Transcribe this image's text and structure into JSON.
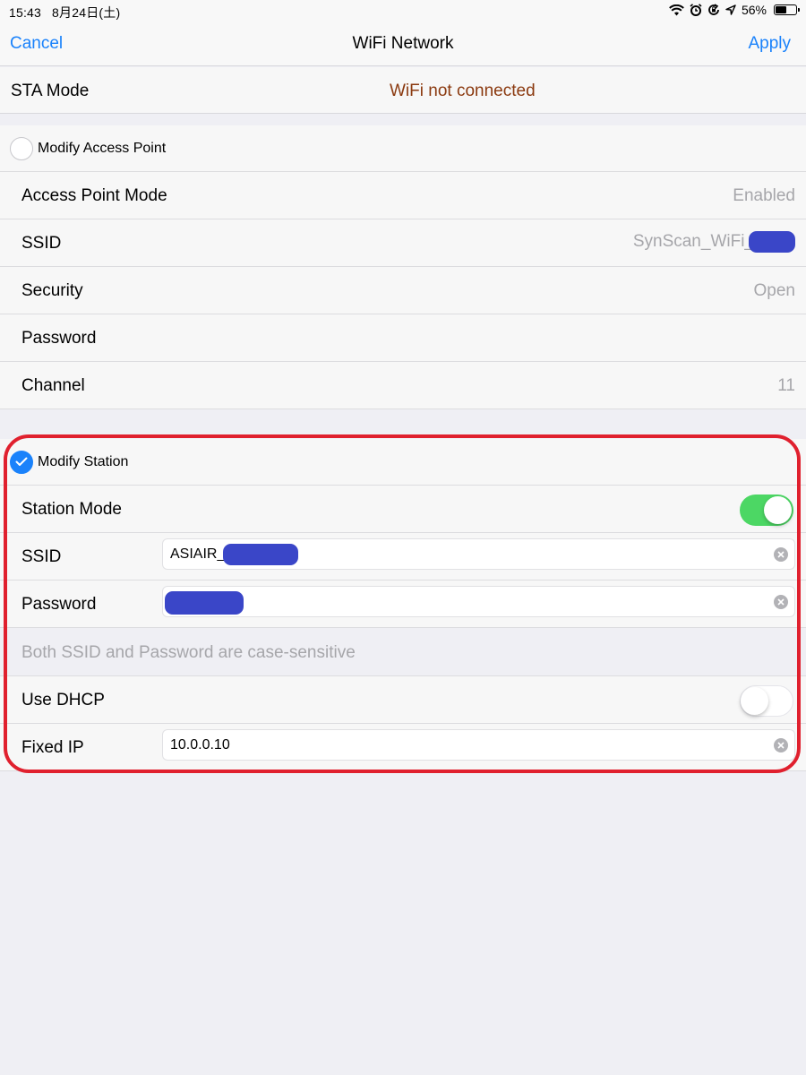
{
  "status_bar": {
    "time": "15:43",
    "date": "8月24日(土)",
    "battery_percent": "56%",
    "battery_level": 0.56,
    "icons": [
      "wifi-icon",
      "alarm-icon",
      "rotation-lock-icon",
      "location-icon",
      "battery-icon"
    ]
  },
  "nav": {
    "cancel": "Cancel",
    "title": "WiFi Network",
    "apply": "Apply"
  },
  "sta": {
    "label": "STA Mode",
    "status": "WiFi not connected"
  },
  "access_point": {
    "header": "Modify Access Point",
    "checked": false,
    "rows": [
      {
        "label": "Access Point Mode",
        "value": "Enabled"
      },
      {
        "label": "SSID",
        "value": "SynScan_WiFi_"
      },
      {
        "label": "Security",
        "value": "Open"
      },
      {
        "label": "Password",
        "value": ""
      },
      {
        "label": "Channel",
        "value": "11"
      }
    ]
  },
  "station": {
    "header": "Modify Station",
    "checked": true,
    "station_mode_label": "Station Mode",
    "station_mode_on": true,
    "ssid_label": "SSID",
    "ssid_value": "ASIAIR_",
    "password_label": "Password",
    "password_value": "",
    "hint": "Both SSID and Password are case-sensitive",
    "dhcp_label": "Use DHCP",
    "dhcp_on": false,
    "fixed_ip_label": "Fixed IP",
    "fixed_ip_value": "10.0.0.10"
  },
  "colors": {
    "accent": "#1a82fb",
    "status_error": "#8b3a10",
    "toggle_on": "#4cd764",
    "highlight": "#e0202e",
    "redaction": "#3a46c8"
  }
}
